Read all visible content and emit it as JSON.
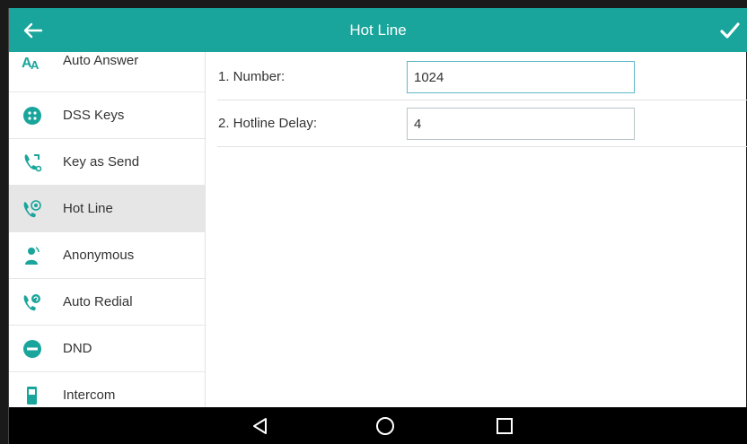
{
  "colors": {
    "accent": "#19a59b",
    "active_row": "#e6e6e6",
    "nav_bar": "#000000"
  },
  "header": {
    "title": "Hot Line",
    "back_icon": "arrow-left-icon",
    "confirm_icon": "checkmark-icon"
  },
  "sidebar": {
    "items": [
      {
        "label": "Auto Answer",
        "icon": "auto-answer-icon",
        "active": false
      },
      {
        "label": "DSS Keys",
        "icon": "dss-keys-icon",
        "active": false
      },
      {
        "label": "Key as Send",
        "icon": "key-as-send-icon",
        "active": false
      },
      {
        "label": "Hot Line",
        "icon": "hot-line-icon",
        "active": true
      },
      {
        "label": "Anonymous",
        "icon": "anonymous-icon",
        "active": false
      },
      {
        "label": "Auto Redial",
        "icon": "auto-redial-icon",
        "active": false
      },
      {
        "label": "DND",
        "icon": "dnd-icon",
        "active": false
      },
      {
        "label": "Intercom",
        "icon": "intercom-icon",
        "active": false
      }
    ]
  },
  "form": {
    "fields": [
      {
        "label": "1. Number:",
        "value": "1024"
      },
      {
        "label": "2. Hotline Delay:",
        "value": "4"
      }
    ]
  },
  "navbar": {
    "icons": [
      "nav-back-icon",
      "nav-home-icon",
      "nav-recents-icon"
    ]
  }
}
